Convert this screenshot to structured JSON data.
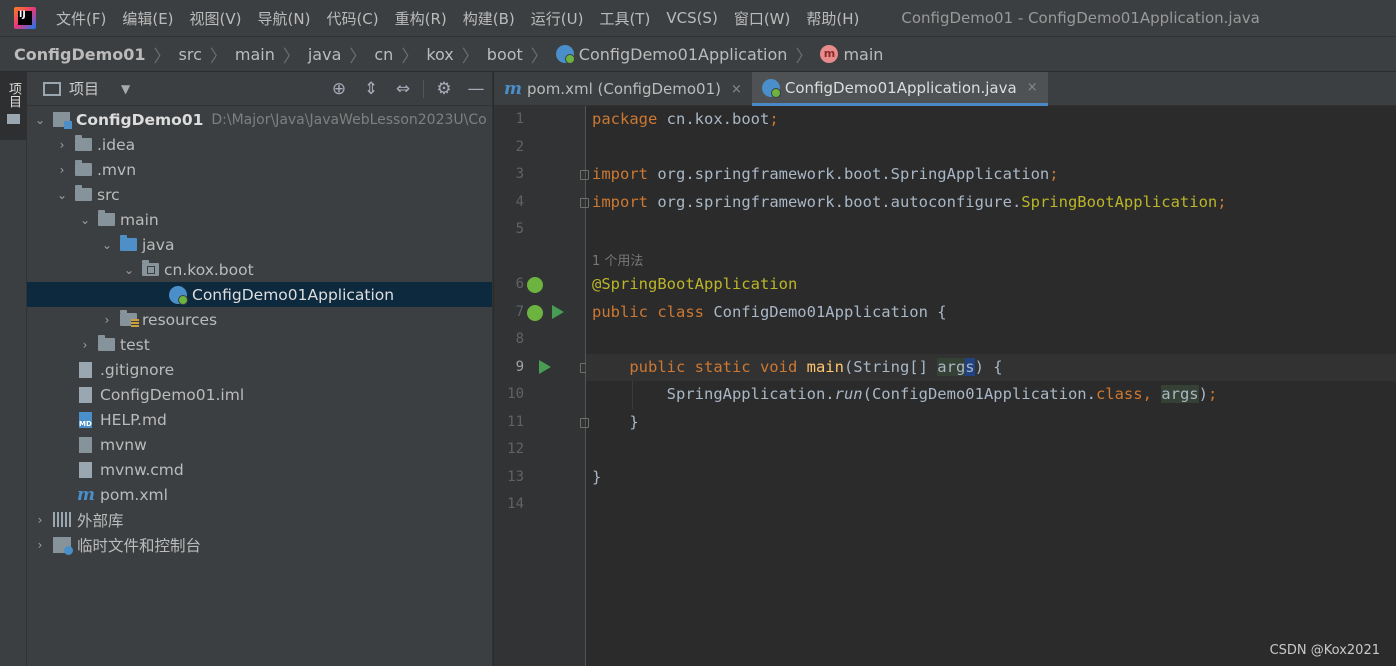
{
  "menubar": {
    "app_logo_text": "IJ",
    "items": [
      "文件(F)",
      "编辑(E)",
      "视图(V)",
      "导航(N)",
      "代码(C)",
      "重构(R)",
      "构建(B)",
      "运行(U)",
      "工具(T)",
      "VCS(S)",
      "窗口(W)",
      "帮助(H)"
    ],
    "window_title": "ConfigDemo01 - ConfigDemo01Application.java"
  },
  "breadcrumb": [
    "ConfigDemo01",
    "src",
    "main",
    "java",
    "cn",
    "kox",
    "boot",
    "ConfigDemo01Application",
    "main"
  ],
  "tool_stripe": {
    "project_label": "项目"
  },
  "project_panel": {
    "title": "项目",
    "tree": [
      {
        "label": "ConfigDemo01",
        "path": "D:\\Major\\Java\\JavaWebLesson2023U\\Co"
      },
      {
        "label": ".idea"
      },
      {
        "label": ".mvn"
      },
      {
        "label": "src"
      },
      {
        "label": "main"
      },
      {
        "label": "java"
      },
      {
        "label": "cn.kox.boot"
      },
      {
        "label": "ConfigDemo01Application"
      },
      {
        "label": "resources"
      },
      {
        "label": "test"
      },
      {
        "label": ".gitignore"
      },
      {
        "label": "ConfigDemo01.iml"
      },
      {
        "label": "HELP.md"
      },
      {
        "label": "mvnw"
      },
      {
        "label": "mvnw.cmd"
      },
      {
        "label": "pom.xml"
      },
      {
        "label": "外部库"
      },
      {
        "label": "临时文件和控制台"
      }
    ]
  },
  "tabs": [
    {
      "label": "pom.xml (ConfigDemo01)",
      "close": "×",
      "icon": "m"
    },
    {
      "label": "ConfigDemo01Application.java",
      "close": "×"
    }
  ],
  "editor": {
    "line_numbers": [
      "1",
      "2",
      "3",
      "4",
      "5",
      "6",
      "7",
      "8",
      "9",
      "10",
      "11",
      "12",
      "13",
      "14"
    ],
    "usage_hint": "1 个用法",
    "code": {
      "l1_kw": "package",
      "l1_rest": " cn.kox.boot",
      "l1_semi": ";",
      "l3_kw": "import",
      "l3_rest": " org.springframework.boot.SpringApplication",
      "l3_semi": ";",
      "l4_kw": "import",
      "l4_rest": " org.springframework.boot.autoconfigure.",
      "l4_ann": "SpringBootApplication",
      "l4_semi": ";",
      "l6_ann": "@SpringBootApplication",
      "l7_kw": "public class",
      "l7_rest": " ConfigDemo01Application {",
      "l9_kw": "    public static void ",
      "l9_method": "main",
      "l9_p1": "(String[] ",
      "l9_arg": "arg",
      "l9_arg2": "s",
      "l9_p2": ") {",
      "l10_a": "        SpringApplication.",
      "l10_run": "run",
      "l10_b": "(ConfigDemo01Application.",
      "l10_kw": "class",
      "l10_comma": ", ",
      "l10_arg": "args",
      "l10_c": ")",
      "l10_semi": ";",
      "l11": "    }",
      "l13": "}"
    }
  },
  "watermark": "CSDN @Kox2021"
}
